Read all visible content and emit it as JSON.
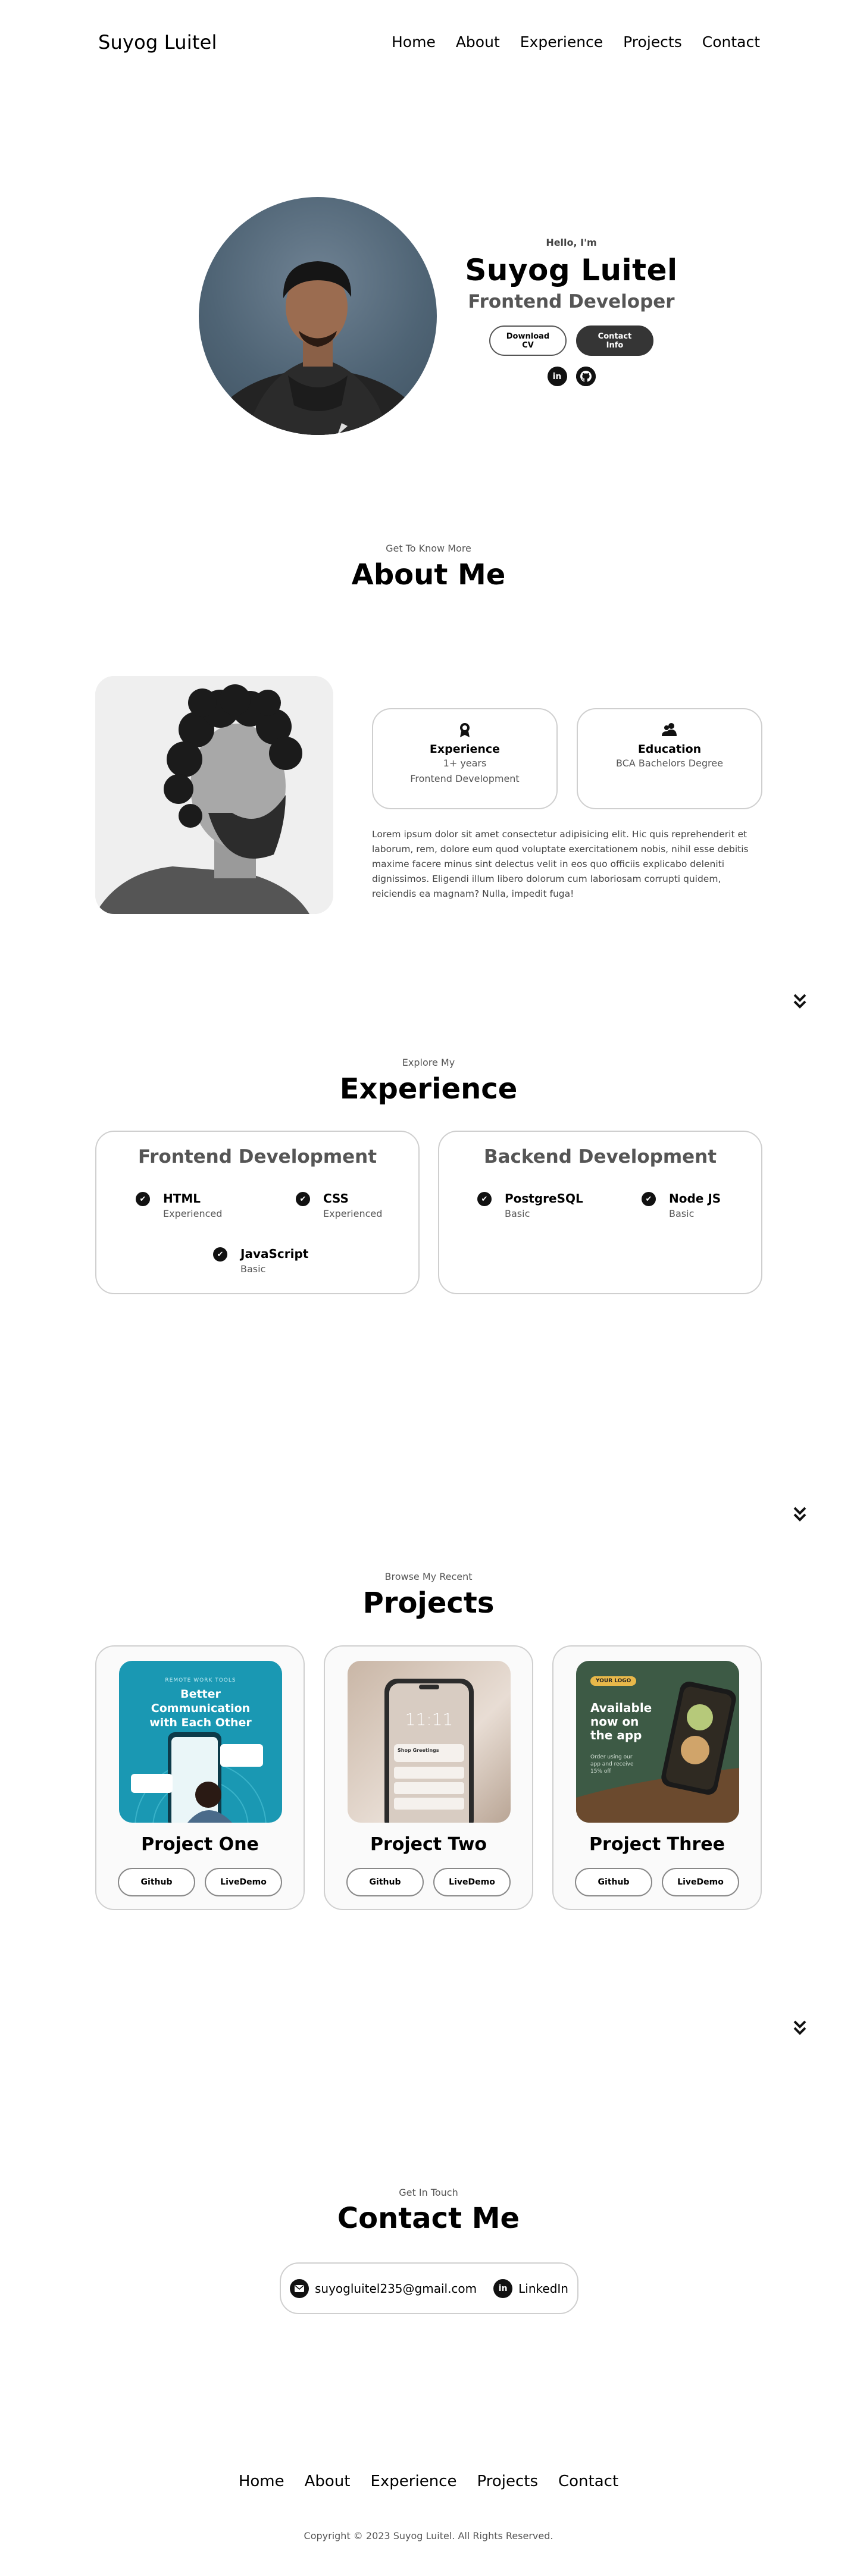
{
  "nav": {
    "logo": "Suyog Luitel",
    "links": [
      "Home",
      "About",
      "Experience",
      "Projects",
      "Contact"
    ]
  },
  "hero": {
    "greeting": "Hello, I'm",
    "name": "Suyog Luitel",
    "role": "Frontend Developer",
    "download_cv": "Download CV",
    "contact_info": "Contact Info",
    "socials": [
      {
        "icon": "linkedin-icon",
        "glyph": "in"
      },
      {
        "icon": "github-icon",
        "glyph": "◉"
      }
    ]
  },
  "about": {
    "subtitle": "Get To Know More",
    "title": "About Me",
    "experience": {
      "title": "Experience",
      "line1": "1+ years",
      "line2": "Frontend Development"
    },
    "education": {
      "title": "Education",
      "line1": "BCA Bachelors Degree"
    },
    "text": "Lorem ipsum dolor sit amet consectetur adipisicing elit. Hic quis reprehenderit et laborum, rem, dolore eum quod voluptate exercitationem nobis, nihil esse debitis maxime facere minus sint delectus velit in eos quo officiis explicabo deleniti dignissimos. Eligendi illum libero dolorum cum laboriosam corrupti quidem, reiciendis ea magnam? Nulla, impedit fuga!"
  },
  "experience": {
    "subtitle": "Explore My",
    "title": "Experience",
    "frontend": {
      "title": "Frontend Development",
      "skills": [
        {
          "name": "HTML",
          "level": "Experienced"
        },
        {
          "name": "CSS",
          "level": "Experienced"
        },
        {
          "name": "JavaScript",
          "level": "Basic"
        }
      ]
    },
    "backend": {
      "title": "Backend Development",
      "skills": [
        {
          "name": "PostgreSQL",
          "level": "Basic"
        },
        {
          "name": "Node JS",
          "level": "Basic"
        }
      ]
    }
  },
  "projects": {
    "subtitle": "Browse My Recent",
    "title": "Projects",
    "items": [
      {
        "name": "Project One",
        "github": "Github",
        "demo": "LiveDemo",
        "img_caption": "Better Communication with Each Other",
        "img_tag": "REMOTE WORK TOOLS"
      },
      {
        "name": "Project Two",
        "github": "Github",
        "demo": "LiveDemo",
        "img_caption": "Shop Greetings",
        "img_tag": "11:11"
      },
      {
        "name": "Project Three",
        "github": "Github",
        "demo": "LiveDemo",
        "img_caption": "Available now on the app",
        "img_tag": "YOUR LOGO",
        "img_sub": "Order using our app and receive 15% off"
      }
    ]
  },
  "contact": {
    "subtitle": "Get In Touch",
    "title": "Contact Me",
    "email": "suyogluitel235@gmail.com",
    "linkedin": "LinkedIn"
  },
  "footer": {
    "links": [
      "Home",
      "About",
      "Experience",
      "Projects",
      "Contact"
    ],
    "copyright": "Copyright © 2023 Suyog Luitel. All Rights Reserved."
  }
}
